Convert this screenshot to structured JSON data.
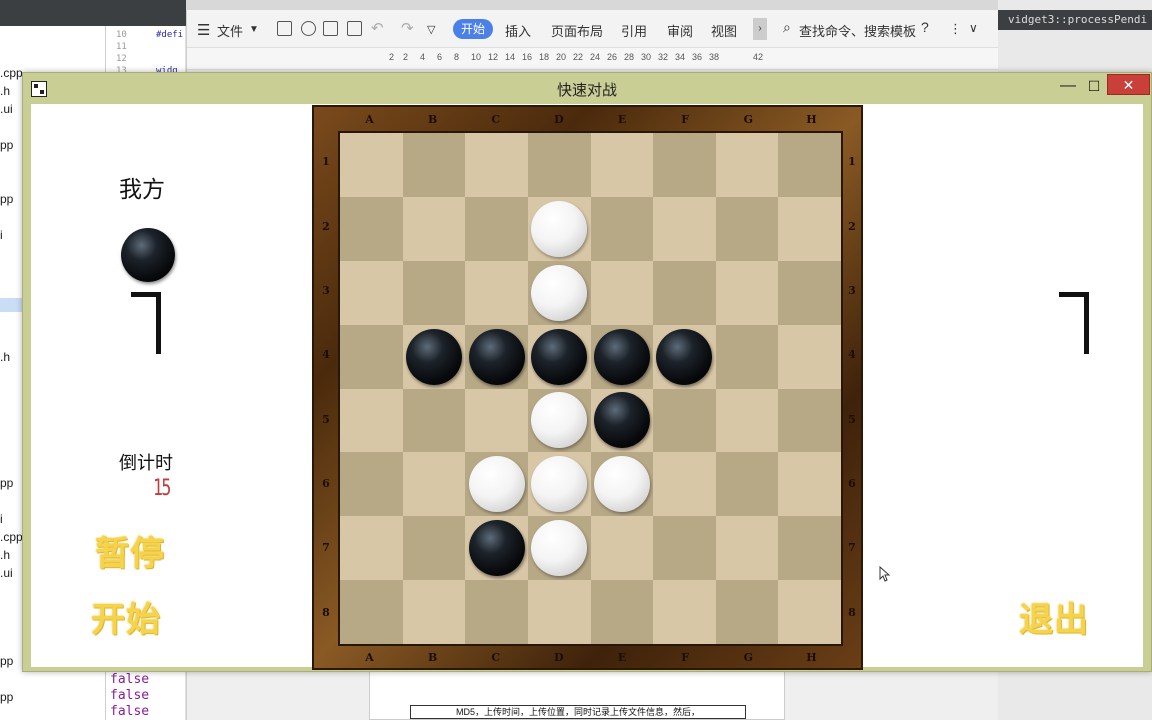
{
  "background": {
    "left_files": [
      ".cpp",
      ".h",
      ".ui",
      "pp",
      "pp",
      "i",
      "",
      ".h",
      "pp",
      "i",
      ".cpp",
      ".h",
      ".ui",
      "pp",
      "pp"
    ],
    "code_line_numbers": [
      "10",
      "11",
      "12",
      "13"
    ],
    "code_fragments": [
      "#defi",
      "widg"
    ],
    "false_values": [
      "false",
      "false",
      "false"
    ],
    "wps": {
      "menu_file": "文件",
      "tab_start": "开始",
      "tab_insert": "插入",
      "tab_layout": "页面布局",
      "tab_reference": "引用",
      "tab_review": "审阅",
      "tab_view": "视图",
      "search_placeholder": "查找命令、搜索模板",
      "ruler_ticks": [
        "2",
        "2",
        "4",
        "6",
        "8",
        "10",
        "12",
        "14",
        "16",
        "18",
        "20",
        "22",
        "24",
        "26",
        "28",
        "30",
        "32",
        "34",
        "36",
        "38",
        "42"
      ],
      "doc_text": "MD5，上传时间，上传位置，同时记录上传文件信息，然后，"
    },
    "right_title": "vidget3::processPendi"
  },
  "window": {
    "title": "快速对战",
    "min_label": "—",
    "max_label": "☐",
    "close_label": "✕"
  },
  "left_panel": {
    "my_label": "我方",
    "my_stone_color": "black",
    "my_score": "7",
    "countdown_label": "倒计时",
    "countdown_value": "15",
    "pause_label": "暂停",
    "start_label": "开始"
  },
  "right_panel": {
    "opponent_score": "7",
    "exit_label": "退出"
  },
  "board": {
    "columns": [
      "A",
      "B",
      "C",
      "D",
      "E",
      "F",
      "G",
      "H"
    ],
    "rows": [
      "1",
      "2",
      "3",
      "4",
      "5",
      "6",
      "7",
      "8"
    ],
    "cells": [
      [
        "",
        "",
        "",
        "",
        "",
        "",
        "",
        ""
      ],
      [
        "",
        "",
        "",
        "W",
        "",
        "",
        "",
        ""
      ],
      [
        "",
        "",
        "",
        "W",
        "",
        "",
        "",
        ""
      ],
      [
        "",
        "B",
        "B",
        "B",
        "B",
        "B",
        "",
        ""
      ],
      [
        "",
        "",
        "",
        "W",
        "B",
        "",
        "",
        ""
      ],
      [
        "",
        "",
        "W",
        "W",
        "W",
        "",
        "",
        ""
      ],
      [
        "",
        "",
        "B",
        "W",
        "",
        "",
        "",
        ""
      ],
      [
        "",
        "",
        "",
        "",
        "",
        "",
        "",
        ""
      ]
    ]
  },
  "colors": {
    "gold_button": "#f5d44b",
    "countdown": "#c23a3a",
    "window_frame": "#c9cf94",
    "close_button": "#c9403a"
  }
}
